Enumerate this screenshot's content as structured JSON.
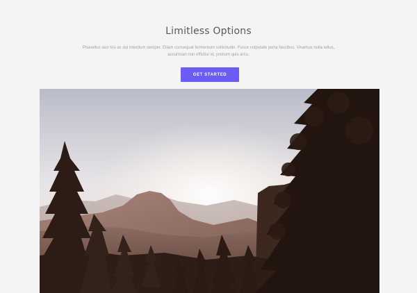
{
  "hero": {
    "title": "Limitless Options",
    "description": "Phasellus sed nisi ac dui interdum semper. Etiam consequat fermentum sollicitudin. Fusce vulputate porta faucibus. Vivamus nulla tellus, accumsan non efficitur id, pretium quis arcu.",
    "button_label": "GET STARTED"
  },
  "image": {
    "alt": "Mountain valley at sunrise framed by pine trees"
  },
  "colors": {
    "background": "#f4f4f4",
    "accent": "#6a5cf5",
    "title": "#555a60",
    "text_muted": "#9ea2a8"
  }
}
